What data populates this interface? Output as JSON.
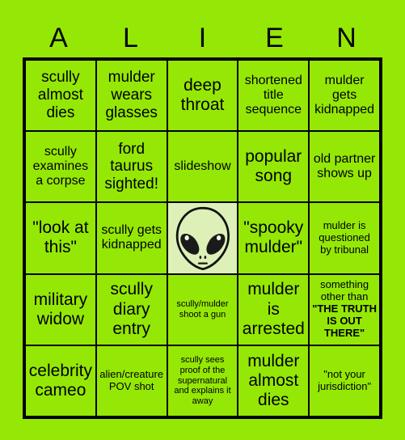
{
  "card": {
    "title_letters": [
      "A",
      "L",
      "I",
      "E",
      "N"
    ],
    "background_color": "#95e805",
    "cell_color": "#95e805",
    "free_space_color": "#dcf0b7",
    "line_color": "#000000",
    "text_color": "#000000"
  },
  "grid": {
    "columns": 5,
    "rows": 5,
    "cells": [
      {
        "text": "scully almost dies",
        "size": "lg"
      },
      {
        "text": "mulder wears glasses",
        "size": "lg"
      },
      {
        "text": "deep throat",
        "size": "xl"
      },
      {
        "text": "shortened title sequence",
        "size": "md"
      },
      {
        "text": "mulder gets kidnapped",
        "size": "md"
      },
      {
        "text": "scully examines a corpse",
        "size": "md"
      },
      {
        "text": "ford taurus sighted!",
        "size": "lg"
      },
      {
        "text": "slideshow",
        "size": "md"
      },
      {
        "text": "popular song",
        "size": "xl"
      },
      {
        "text": "old partner shows up",
        "size": "md"
      },
      {
        "text": "\"look at this\"",
        "size": "xl"
      },
      {
        "text": "scully gets kidnapped",
        "size": "md"
      },
      {
        "text": "",
        "size": "md",
        "free_space": true,
        "icon": "alien-head-icon"
      },
      {
        "text": "\"spooky mulder\"",
        "size": "xl"
      },
      {
        "text": "mulder is questioned by tribunal",
        "size": "sm"
      },
      {
        "text": "military widow",
        "size": "xl"
      },
      {
        "text": "scully diary entry",
        "size": "xl"
      },
      {
        "text": "scully/mulder shoot a gun",
        "size": "xs"
      },
      {
        "text": "mulder is arrested",
        "size": "xl"
      },
      {
        "text": "something other than ",
        "bold_text": "\"THE TRUTH IS OUT THERE\"",
        "size": "sm"
      },
      {
        "text": "celebrity cameo",
        "size": "xl"
      },
      {
        "text": "alien/creature POV shot",
        "size": "sm"
      },
      {
        "text": "scully sees proof of the supernatural and explains it away",
        "size": "xs"
      },
      {
        "text": "mulder almost dies",
        "size": "xl"
      },
      {
        "text": "\"not your jurisdiction\"",
        "size": "sm"
      }
    ]
  }
}
